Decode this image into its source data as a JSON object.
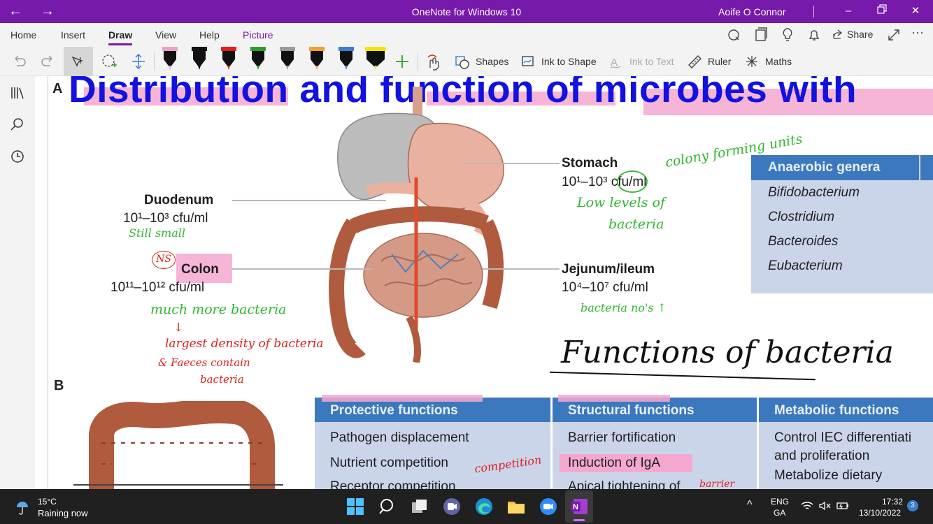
{
  "window": {
    "title": "OneNote for Windows 10",
    "user": "Aoife O Connor"
  },
  "ribbon": {
    "tabs": [
      {
        "label": "Home"
      },
      {
        "label": "Insert"
      },
      {
        "label": "Draw"
      },
      {
        "label": "View"
      },
      {
        "label": "Help"
      },
      {
        "label": "Picture"
      }
    ],
    "active_tab": "Draw",
    "share_label": "Share"
  },
  "toolbar": {
    "shapes_label": "Shapes",
    "ink_to_shape_label": "Ink to Shape",
    "ink_to_text_label": "Ink to Text",
    "ruler_label": "Ruler",
    "maths_label": "Maths",
    "pen_colors": [
      "#e8a0c8",
      "#111111",
      "#e0201a",
      "#2aa12a",
      "#9a9a9a",
      "#f0a030",
      "#3a7fd0",
      "#f5e600"
    ]
  },
  "page": {
    "title": "Distribution and function of microbes with",
    "section_a": "A",
    "section_b": "B",
    "organs": {
      "stomach": {
        "name": "Stomach",
        "count": "10¹–10³ cfu/ml"
      },
      "duodenum": {
        "name": "Duodenum",
        "count": "10¹–10³ cfu/ml"
      },
      "colon": {
        "name": "Colon",
        "count": "10¹¹–10¹² cfu/ml"
      },
      "jejunum": {
        "name": "Jejunum/ileum",
        "count": "10⁴–10⁷ cfu/ml"
      }
    },
    "genera_table": {
      "header": "Anaerobic genera",
      "rows": [
        "Bifidobacterium",
        "Clostridium",
        "Bacteroides",
        "Eubacterium"
      ]
    },
    "functions_table": {
      "columns": [
        {
          "header": "Protective functions",
          "items": [
            "Pathogen displacement",
            "Nutrient competition",
            "Receptor competition"
          ]
        },
        {
          "header": "Structural functions",
          "items": [
            "Barrier fortification",
            "Induction of IgA",
            "Apical tightening of"
          ]
        },
        {
          "header": "Metabolic functions",
          "items": [
            "Control IEC differentiati and proliferation",
            "Metabolize dietary"
          ]
        }
      ]
    },
    "ink": {
      "colony_forming_units": "colony forming units",
      "low_levels": "Low levels of",
      "bacteria_1": "bacteria",
      "still_small": "Still small",
      "ns": "NS",
      "much_more": "much more bacteria",
      "largest_density": "largest density of bacteria",
      "faeces_contain": "& Faeces contain",
      "bacteria_2": "bacteria",
      "bacteria_nos": "bacteria no's ↑",
      "functions_of_bacteria": "Functions of bacteria",
      "competition": "competition",
      "barrier": "barrier"
    }
  },
  "taskbar": {
    "weather_temp": "15°C",
    "weather_desc": "Raining now",
    "lang_top": "ENG",
    "lang_bottom": "GA",
    "time": "17:32",
    "date": "13/10/2022",
    "notification_count": "3"
  }
}
